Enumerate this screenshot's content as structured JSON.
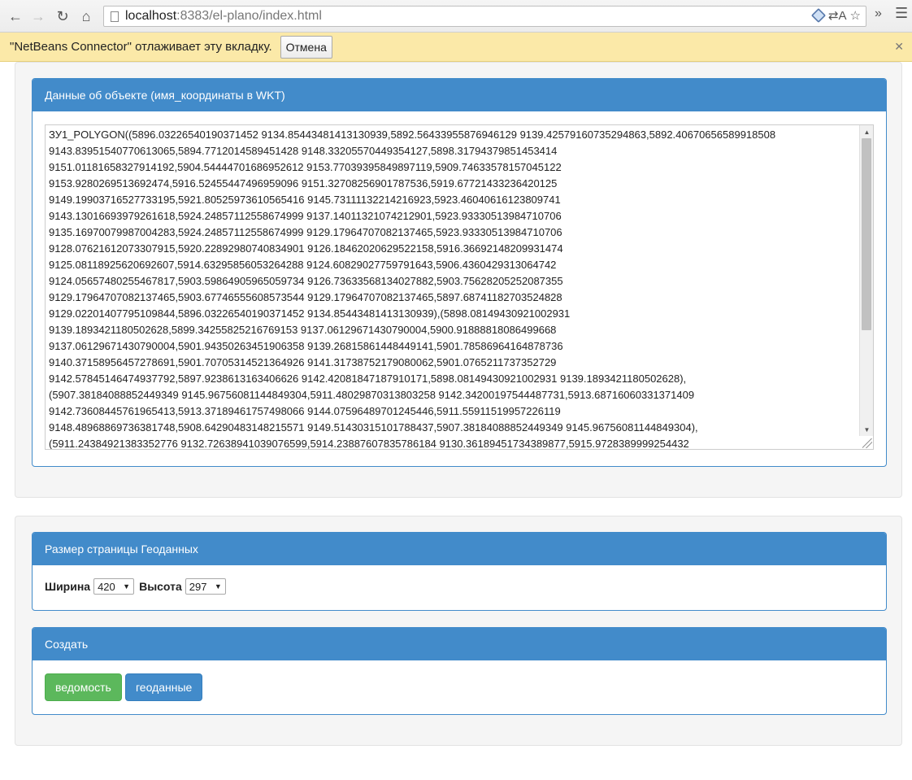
{
  "browser": {
    "url_host": "localhost",
    "url_rest": ":8383/el-plano/index.html",
    "infobar_text": "\"NetBeans Connector\" отлаживает эту вкладку.",
    "infobar_button": "Отмена"
  },
  "wkt_panel": {
    "title": "Данные об объекте (имя_координаты в WKT)",
    "lines": [
      "ЗУ1_POLYGON((5896.03226540190371452 9134.85443481413130939,5892.56433955876946129 9139.42579160735294863,5892.40670656589918508",
      "9143.83951540770613065,5894.7712014589451428 9148.33205570449354127,5898.31794379851453414",
      "9151.01181658327914192,5904.54444701686952612 9153.77039395849897119,5909.74633578157045122",
      "9153.9280269513692474,5916.52455447496959096 9151.32708256901787536,5919.67721433236420125",
      "9149.19903716527733195,5921.80525973610565416 9145.73111132214216923,5923.46040616123809741",
      "9143.13016693979261618,5924.24857112558674999 9137.14011321074212901,5923.93330513984710706",
      "9135.16970079987004283,5924.24857112558674999 9129.17964707082137465,5923.93330513984710706",
      "9128.07621612073307915,5920.22892980740834901 9126.18462020629522158,5916.36692148209931474",
      "9125.08118925620692607,5914.63295856053264288 9124.60829027759791643,5906.4360429313064742",
      "9124.05657480255467817,5903.59864905965059734 9126.73633568134027882,5903.75628205252087355",
      "9129.17964707082137465,5903.67746555608573544 9129.17964707082137465,5897.68741182703524828",
      "9129.02201407795109844,5896.03226540190371452 9134.85443481413130939),(5898.08149430921002931",
      "9139.1893421180502628,5899.34255825216769153 9137.06129671430790004,5900.91888818086499668",
      "9137.06129671430790004,5901.94350263451906358 9139.26815861448449141,5901.78586964164878736",
      "9140.37158956457278691,5901.70705314521364926 9141.31738752179080062,5901.0765211737352729",
      "9142.57845146474937792,5897.9238613163406626 9142.42081847187910171,5898.08149430921002931 9139.1893421180502628),",
      "(5907.38184088852449349 9145.96756081144849304,5911.48029870313803258 9142.34200197544487731,5913.68716060331371409",
      "9142.73608445761965413,5913.37189461757498066 9144.07596489701245446,5911.55911519957226119",
      "9148.48968869736381748,5908.64290483148215571 9149.51430315101788437,5907.38184088852449349 9145.96756081144849304),",
      "(5911.24384921383352776 9132.72638941039076599,5914.23887607835786184 9130.36189451734389877,5915.9728389999254432"
    ]
  },
  "size_panel": {
    "title": "Размер страницы Геоданных",
    "width_label": "Ширина",
    "width_value": "420",
    "height_label": "Высота",
    "height_value": "297"
  },
  "create_panel": {
    "title": "Создать",
    "btn_statement": "ведомость",
    "btn_geodata": "геоданные"
  },
  "colors": {
    "primary": "#428bca",
    "success": "#5cb85c",
    "infobar": "#fbe9a8"
  }
}
